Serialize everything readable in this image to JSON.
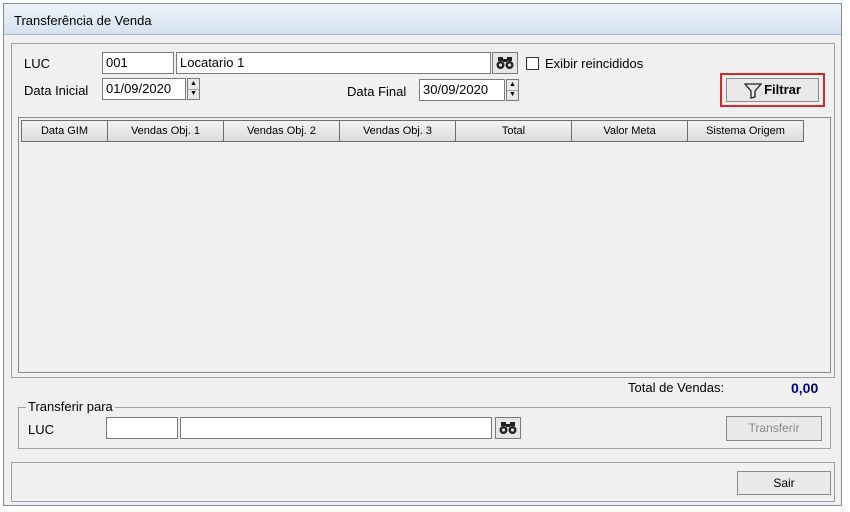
{
  "window": {
    "title": "Transferência de Venda"
  },
  "filter": {
    "luc_label": "LUC",
    "luc_code": "001",
    "luc_name": "Locatario 1",
    "search_icon": "binoculars-icon",
    "checkbox_label": "Exibir reincididos",
    "checkbox_checked": false,
    "date_start_label": "Data Inicial",
    "date_start": "01/09/2020",
    "date_end_label": "Data Final",
    "date_end": "30/09/2020",
    "filter_button": "Filtrar",
    "filter_icon": "funnel-icon"
  },
  "grid": {
    "columns": [
      "Data GIM",
      "Vendas Obj. 1",
      "Vendas Obj. 2",
      "Vendas Obj. 3",
      "Total",
      "Valor Meta",
      "Sistema Origem"
    ],
    "rows": []
  },
  "totals": {
    "label": "Total de Vendas:",
    "value": "0,00",
    "value_color": "#00007f"
  },
  "transfer": {
    "group_label": "Transferir para",
    "luc_label": "LUC",
    "luc_code": "",
    "luc_name": "",
    "search_icon": "binoculars-icon",
    "button": "Transferir"
  },
  "footer": {
    "exit_button": "Sair"
  },
  "colors": {
    "highlight": "#d9262b"
  }
}
